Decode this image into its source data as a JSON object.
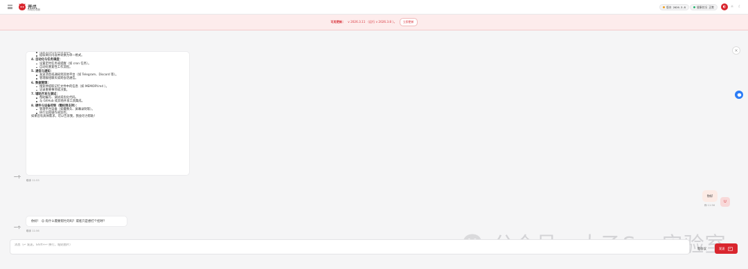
{
  "header": {
    "brand_title": "开爪",
    "brand_subtitle": "网络处理器",
    "version_label": "版本",
    "version_value": "2026.3.8",
    "health_label": "健康状况",
    "health_value": "正常",
    "colors": {
      "accent": "#d9262e",
      "version_dot": "#f0a020",
      "health_dot": "#2bb673"
    }
  },
  "banner": {
    "label": "可用更新：",
    "text": "v 2026.3.11 （运行 v 2026.3.8 ）。",
    "button": "立即更新"
  },
  "messages": {
    "assistant_long": {
      "lines": [
        {
          "kind": "sub",
          "text": "搜索全网的新闻和信息。"
        },
        {
          "kind": "sub",
          "text": "提取网页内容并转换为单一格式。"
        },
        {
          "kind": "head",
          "text": "4. 自动化与任务调度："
        },
        {
          "kind": "sub",
          "text": "设置定时任务或提醒（如 cron 任务）。"
        },
        {
          "kind": "sub",
          "text": "自动化重复性工作流程。"
        },
        {
          "kind": "head",
          "text": "5. 通信与通知："
        },
        {
          "kind": "sub",
          "text": "发送消息或通知到其他平台（如 Telegram、Discord 等）。"
        },
        {
          "kind": "sub",
          "text": "管理群组聊天或跨会话通信。"
        },
        {
          "kind": "head",
          "text": "6. 数据管理："
        },
        {
          "kind": "sub",
          "text": "搜索并提取记忆文件中的信息（如 MEMORY.md ）。"
        },
        {
          "kind": "sub",
          "text": "记录重要事项或决策。"
        },
        {
          "kind": "head",
          "text": "7. 辅助开发与调试："
        },
        {
          "kind": "sub",
          "text": "帮助编写、调试或优化代码。"
        },
        {
          "kind": "sub",
          "text": "与 GitHub 或其他开发工具集成。"
        },
        {
          "kind": "head",
          "text": "8. 硬件与设备控制（需权限支持）："
        },
        {
          "kind": "sub",
          "text": "管理平台设备（如摄像头、屏幕录制等）。"
        },
        {
          "kind": "sub",
          "text": "执行远程操作或监控。"
        },
        {
          "kind": "plain",
          "text": "如果您有具体需求，可以告诉我，我会尽力帮助！"
        }
      ],
      "sender_label": "一个",
      "meta_name": "助手",
      "meta_time": "11:53"
    },
    "user": {
      "text": "你好",
      "avatar": "U",
      "meta_name": "你",
      "meta_time": "11:56"
    },
    "assistant_short": {
      "text": "你好！ 😊 有什么需要帮忙的吗？或者只是想打个招呼？",
      "sender_label": "一个",
      "meta_name": "助手",
      "meta_time": "11:56"
    }
  },
  "composer": {
    "placeholder": "消息（↩ 发送，Shift+↩ 换行，粘贴图片）",
    "new_session": "新会议",
    "send": "发送"
  },
  "watermark": {
    "text": "公众号 · 太乙Sec实验室"
  }
}
